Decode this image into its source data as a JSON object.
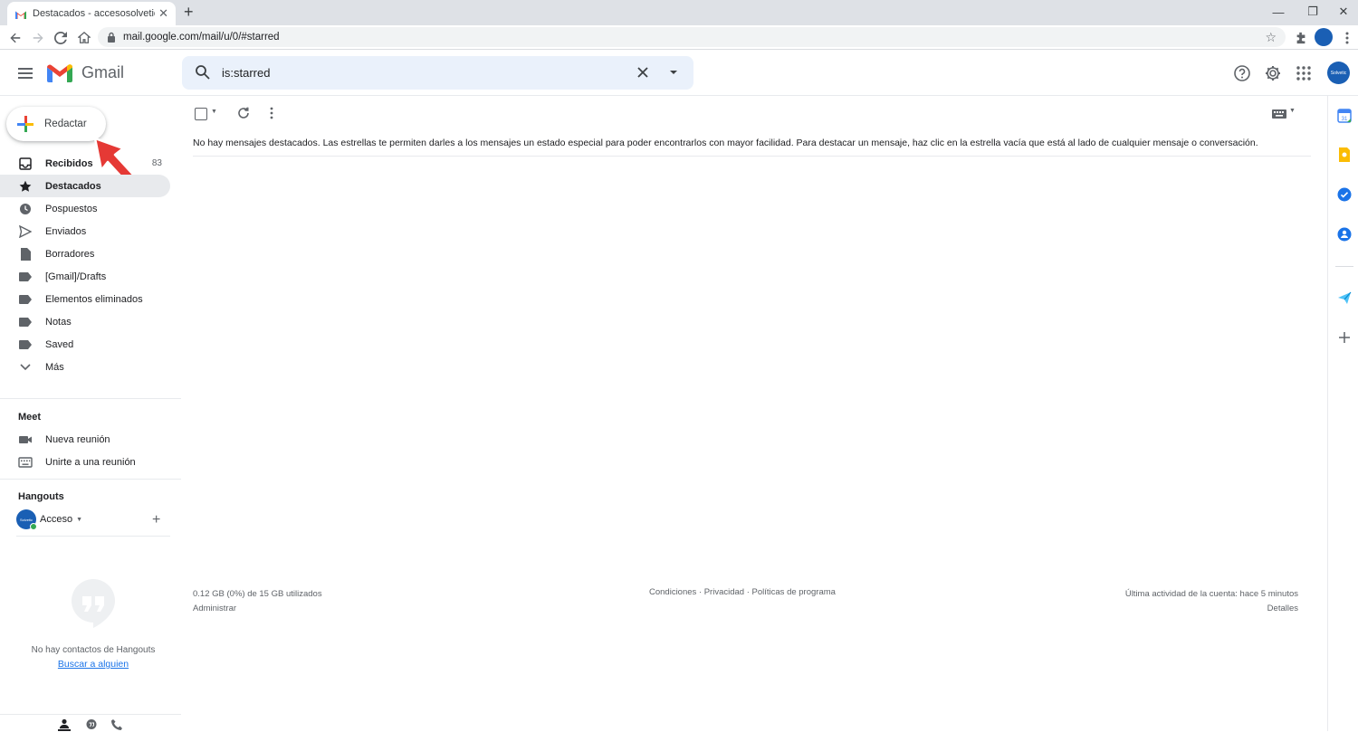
{
  "browser": {
    "tab_title": "Destacados - accesosolvetic1@g",
    "new_tab": "+",
    "url": "mail.google.com/mail/u/0/#starred"
  },
  "header": {
    "app_name": "Gmail",
    "search_query": "is:starred",
    "avatar_text": "Solvetic"
  },
  "compose": {
    "label": "Redactar"
  },
  "nav": {
    "items": [
      {
        "label": "Recibidos",
        "count": "83",
        "icon": "inbox-icon"
      },
      {
        "label": "Destacados",
        "icon": "star-icon"
      },
      {
        "label": "Pospuestos",
        "icon": "clock-icon"
      },
      {
        "label": "Enviados",
        "icon": "send-icon"
      },
      {
        "label": "Borradores",
        "icon": "draft-icon"
      },
      {
        "label": "[Gmail]/Drafts",
        "icon": "label-icon"
      },
      {
        "label": "Elementos eliminados",
        "icon": "label-icon"
      },
      {
        "label": "Notas",
        "icon": "label-icon"
      },
      {
        "label": "Saved",
        "icon": "label-icon"
      },
      {
        "label": "Más",
        "icon": "chevron-down-icon"
      }
    ]
  },
  "meet": {
    "title": "Meet",
    "new_meeting": "Nueva reunión",
    "join_meeting": "Unirte a una reunión"
  },
  "hangouts": {
    "title": "Hangouts",
    "user": "Acceso",
    "avatar_text": "Solvetic",
    "empty_text": "No hay contactos de Hangouts",
    "find_link": "Buscar a alguien"
  },
  "main": {
    "empty_message": "No hay mensajes destacados. Las estrellas te permiten darles a los mensajes un estado especial para poder encontrarlos con mayor facilidad. Para destacar un mensaje, haz clic en la estrella vacía que está al lado de cualquier mensaje o conversación.",
    "storage": "0.12 GB (0%) de 15 GB utilizados",
    "manage": "Administrar",
    "links": "Condiciones · Privacidad · Políticas de programa",
    "last_activity": "Última actividad de la cuenta: hace 5 minutos",
    "details": "Detalles"
  },
  "colors": {
    "active_nav_bg": "#e8eaed",
    "search_bg": "#eaf1fb",
    "link": "#1a73e8",
    "avatar": "#1a5fb4",
    "annotation_arrow": "#e53935"
  }
}
